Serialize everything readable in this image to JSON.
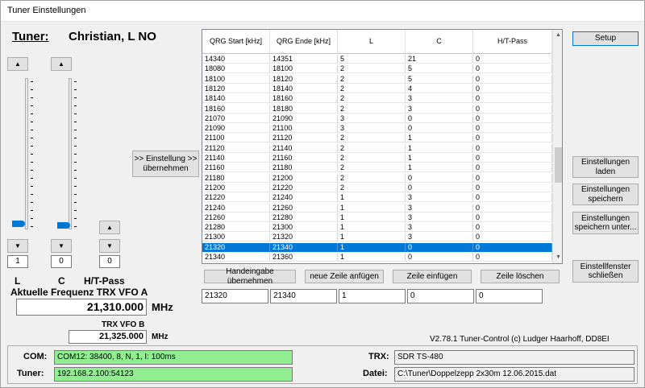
{
  "window": {
    "title": "Tuner Einstellungen"
  },
  "header": {
    "tuner_label": "Tuner:",
    "tuner_name": "Christian, L NO"
  },
  "sliders": {
    "l": {
      "label": "L",
      "value": "1",
      "up": "▲",
      "down": "▼"
    },
    "c": {
      "label": "C",
      "value": "0",
      "up": "▲",
      "down": "▼"
    },
    "ht": {
      "label": "H/T-Pass",
      "value": "0",
      "up": "▲",
      "down": "▼"
    }
  },
  "buttons": {
    "uebernehmen": ">> Einstellung >> übernehmen",
    "setup": "Setup",
    "laden": "Einstellungen laden",
    "speichern": "Einstellungen speichern",
    "speichern_unter": "Einstellungen speichern unter...",
    "schliessen": "Einstellfenster schließen",
    "handeingabe": "Handeingabe übernehmen",
    "neue_zeile": "neue Zeile anfügen",
    "zeile_einfuegen": "Zeile einfügen",
    "zeile_loeschen": "Zeile löschen"
  },
  "table": {
    "columns": [
      "QRG Start [kHz]",
      "QRG Ende [kHz]",
      "L",
      "C",
      "H/T-Pass"
    ],
    "rows": [
      [
        "14340",
        "14351",
        "5",
        "21",
        "0"
      ],
      [
        "18080",
        "18100",
        "2",
        "5",
        "0"
      ],
      [
        "18100",
        "18120",
        "2",
        "5",
        "0"
      ],
      [
        "18120",
        "18140",
        "2",
        "4",
        "0"
      ],
      [
        "18140",
        "18160",
        "2",
        "3",
        "0"
      ],
      [
        "18160",
        "18180",
        "2",
        "3",
        "0"
      ],
      [
        "21070",
        "21090",
        "3",
        "0",
        "0"
      ],
      [
        "21090",
        "21100",
        "3",
        "0",
        "0"
      ],
      [
        "21100",
        "21120",
        "2",
        "1",
        "0"
      ],
      [
        "21120",
        "21140",
        "2",
        "1",
        "0"
      ],
      [
        "21140",
        "21160",
        "2",
        "1",
        "0"
      ],
      [
        "21160",
        "21180",
        "2",
        "1",
        "0"
      ],
      [
        "21180",
        "21200",
        "2",
        "0",
        "0"
      ],
      [
        "21200",
        "21220",
        "2",
        "0",
        "0"
      ],
      [
        "21220",
        "21240",
        "1",
        "3",
        "0"
      ],
      [
        "21240",
        "21260",
        "1",
        "3",
        "0"
      ],
      [
        "21260",
        "21280",
        "1",
        "3",
        "0"
      ],
      [
        "21280",
        "21300",
        "1",
        "3",
        "0"
      ],
      [
        "21300",
        "21320",
        "1",
        "3",
        "0"
      ],
      [
        "21320",
        "21340",
        "1",
        "0",
        "0"
      ],
      [
        "21340",
        "21360",
        "1",
        "0",
        "0"
      ]
    ],
    "selected_index": 19,
    "scroll_up": "▲",
    "scroll_down": "▼"
  },
  "edit_row": {
    "start": "21320",
    "end": "21340",
    "l": "1",
    "c": "0",
    "ht": "0"
  },
  "frequency": {
    "vfo_a_label": "Aktuelle Frequenz TRX VFO A",
    "vfo_a_value": "21,310.000",
    "vfo_a_unit": "MHz",
    "vfo_b_label": "TRX VFO B",
    "vfo_b_value": "21,325.000",
    "vfo_b_unit": "MHz"
  },
  "version": "V2.78.1 Tuner-Control (c) Ludger Haarhoff, DD8EI",
  "status": {
    "com_label": "COM:",
    "com_value": "COM12: 38400, 8, N, 1,  I: 100ms",
    "tuner_label": "Tuner:",
    "tuner_value": "192.168.2.100:54123",
    "trx_label": "TRX:",
    "trx_value": "SDR TS-480",
    "datei_label": "Datei:",
    "datei_value": "C:\\Tuner\\Doppelzepp 2x30m 12.06.2015.dat"
  },
  "colors": {
    "accent": "#0078d7",
    "status_green": "#90ee90"
  }
}
